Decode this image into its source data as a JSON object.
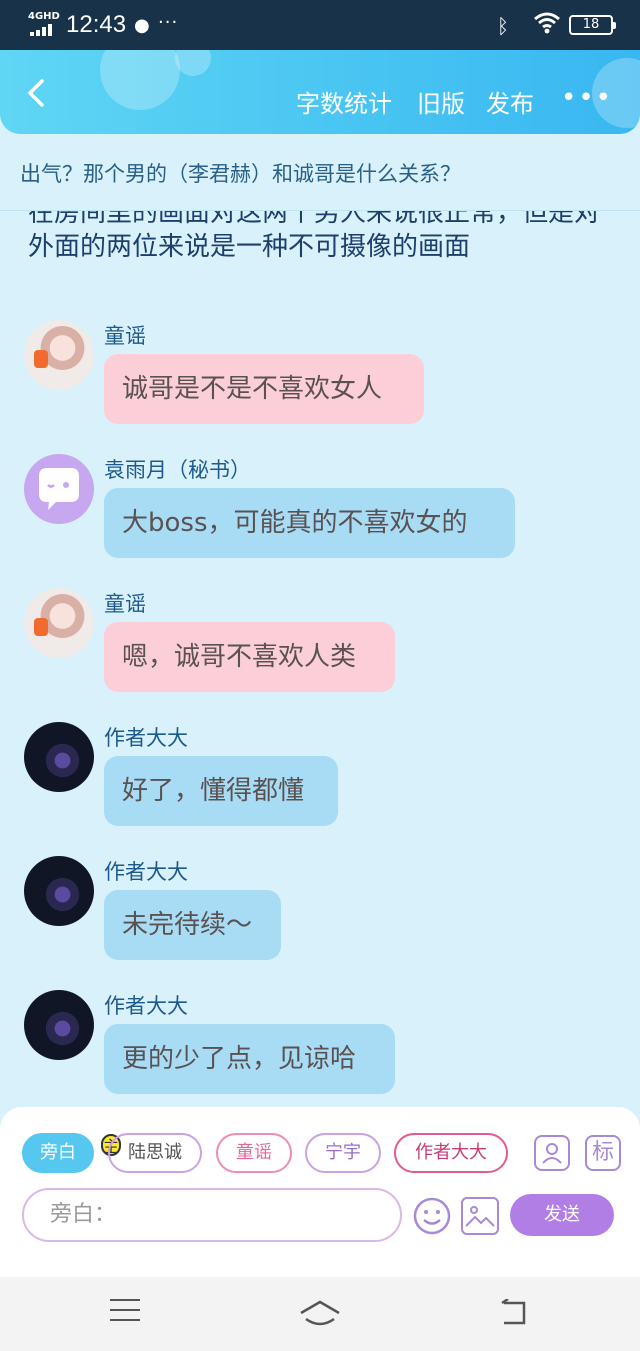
{
  "status": {
    "network": "4GHD",
    "time": "12:43",
    "battery": "18"
  },
  "header": {
    "back_label": "‹",
    "word_count": "字数统计",
    "old_version": "旧版",
    "publish": "发布",
    "more": "•••"
  },
  "story_title": "出气？那个男的（李君赫）和诚哥是什么关系？",
  "narration": "在房间里的画面对这两个男人来说很正常，但是对外面的两位来说是一种不可摄像的画面",
  "messages": [
    {
      "name": "童谣",
      "text": "诚哥是不是不喜欢女人",
      "style": "pink",
      "avatar": "girl"
    },
    {
      "name": "袁雨月（秘书）",
      "text": "大boss，可能真的不喜欢女的",
      "style": "blue",
      "avatar": "bot"
    },
    {
      "name": "童谣",
      "text": "嗯，诚哥不喜欢人类",
      "style": "pink",
      "avatar": "girl"
    },
    {
      "name": "作者大大",
      "text": "好了，懂得都懂",
      "style": "blue",
      "avatar": "dark"
    },
    {
      "name": "作者大大",
      "text": "未完待续～",
      "style": "blue",
      "avatar": "dark"
    },
    {
      "name": "作者大大",
      "text": "更的少了点，见谅哈",
      "style": "blue",
      "avatar": "dark"
    }
  ],
  "roles": {
    "narrator": "旁白",
    "main_tag": "主",
    "r1": "陆思诚",
    "r2": "童谣",
    "r3": "宁宇",
    "r4": "作者大大"
  },
  "tools": {
    "mark": "标"
  },
  "composer": {
    "placeholder": "旁白：",
    "send": "发送"
  },
  "colors": {
    "accent_blue": "#38b7f1",
    "pink_bubble": "#fccfd8",
    "blue_bubble": "#a8dcf5",
    "send_purple": "#b17ee6"
  }
}
